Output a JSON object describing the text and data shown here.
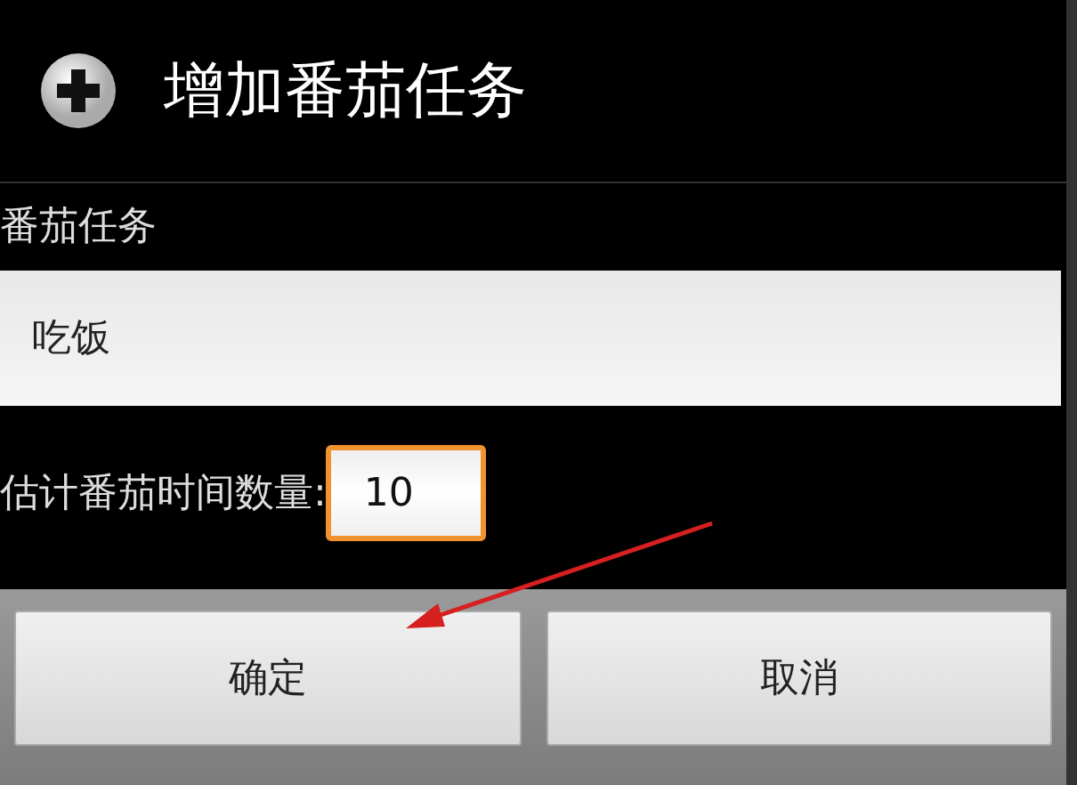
{
  "dialog": {
    "title": "增加番茄任务"
  },
  "task_field": {
    "label": "番茄任务",
    "value": "吃饭"
  },
  "count_field": {
    "label": "估计番茄时间数量:",
    "value": "10",
    "focused": true
  },
  "buttons": [
    {
      "label": "确定"
    },
    {
      "label": "取消"
    }
  ]
}
